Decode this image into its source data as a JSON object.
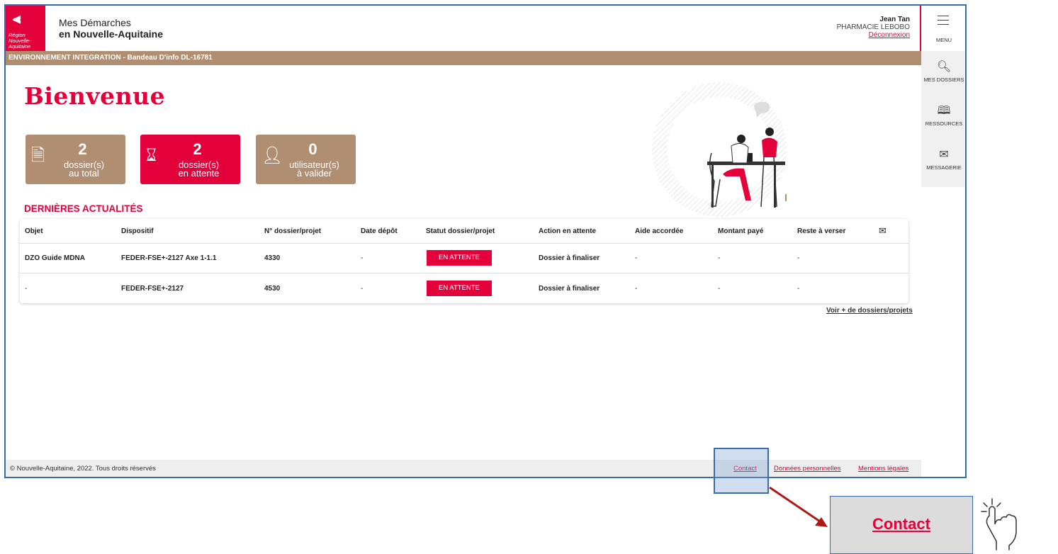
{
  "header": {
    "logo_text": "Région Nouvelle-Aquitaine",
    "app_title_line1": "Mes Démarches",
    "app_title_line2": "en Nouvelle-Aquitaine",
    "user_name": "Jean Tan",
    "organisation": "PHARMACIE LEBOBO",
    "logout": "Déconnexion"
  },
  "banner": "ENVIRONNEMENT INTEGRATION - Bandeau D'info DL-16781",
  "rail": {
    "menu": "MENU",
    "items": [
      "MES DOSSIERS",
      "RESSOURCES",
      "MESSAGERIE"
    ]
  },
  "page_title": "Bienvenue",
  "cards": [
    {
      "count": "2",
      "line1": "dossier(s)",
      "line2": "au total"
    },
    {
      "count": "2",
      "line1": "dossier(s)",
      "line2": "en attente"
    },
    {
      "count": "0",
      "line1": "utilisateur(s)",
      "line2": "à valider"
    }
  ],
  "news_title": "DERNIÈRES ACTUALITÉS",
  "table": {
    "columns": [
      "Objet",
      "Dispositif",
      "N° dossier/projet",
      "Date dépôt",
      "Statut dossier/projet",
      "Action en attente",
      "Aide accordée",
      "Montant payé",
      "Reste à verser"
    ],
    "rows": [
      [
        "DZO Guide MDNA",
        "FEDER-FSE+-2127 Axe 1-1.1",
        "4330",
        "-",
        "EN ATTENTE",
        "Dossier à finaliser",
        "-",
        "-",
        "-"
      ],
      [
        "-",
        "FEDER-FSE+-2127",
        "4530",
        "-",
        "EN ATTENTE",
        "Dossier à finaliser",
        "-",
        "-",
        "-"
      ]
    ]
  },
  "more_link": "Voir + de dossiers/projets",
  "footer": {
    "copyright": "© Nouvelle-Aquitaine, 2022. Tous droits réservés",
    "links": [
      "Contact",
      "Données personnelles",
      "Mentions légales"
    ]
  },
  "zoom_label": "Contact",
  "colors": {
    "brand_red": "#e4003a",
    "tan": "#b08e72",
    "annotation_blue": "#3a6bab"
  }
}
